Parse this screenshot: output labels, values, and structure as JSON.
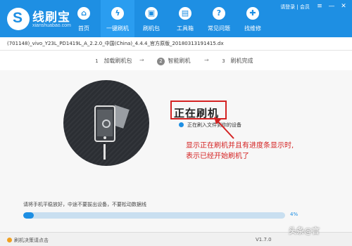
{
  "app": {
    "brand_name": "线刷宝",
    "brand_sub": "xianshuabao.com"
  },
  "nav": [
    {
      "label": "首页",
      "icon": "home-icon",
      "glyph": "⌂"
    },
    {
      "label": "一键刷机",
      "icon": "lightning-icon",
      "glyph": "ϟ"
    },
    {
      "label": "刷机包",
      "icon": "package-icon",
      "glyph": "▣"
    },
    {
      "label": "工具箱",
      "icon": "toolbox-icon",
      "glyph": "▤"
    },
    {
      "label": "常见问题",
      "icon": "faq-icon",
      "glyph": "?"
    },
    {
      "label": "找维修",
      "icon": "repair-icon",
      "glyph": "✚"
    }
  ],
  "header": {
    "user_text": "请登录 | 会员"
  },
  "window_controls": [
    "≡",
    "—",
    "✕"
  ],
  "file": {
    "path": "(701148)_vivo_Y23L_PD1419L_A_2.2.0_中国(China)_4.4.4_官方原版_20180313191415.dx"
  },
  "steps": [
    {
      "num": "1",
      "label": "加载刷机包",
      "state": "done"
    },
    {
      "num": "2",
      "label": "智能刷机",
      "state": "active"
    },
    {
      "num": "3",
      "label": "刷机完成",
      "state": "pending"
    }
  ],
  "step_arrow": "→",
  "status": {
    "title": "正在刷机",
    "sub": "正在刷入文件到你的设备"
  },
  "annotation": {
    "line1": "显示正在刷机并且有进度条显示时,",
    "line2": "表示已经开始刷机了"
  },
  "progress": {
    "hint": "请将手机平稳放好，中途不要拔出设备，不要松动数据线",
    "value": 0.04,
    "label": "4%"
  },
  "footer": {
    "left": "刷机决策请点击",
    "version": "V1.7.0"
  },
  "watermark": "头条@言"
}
